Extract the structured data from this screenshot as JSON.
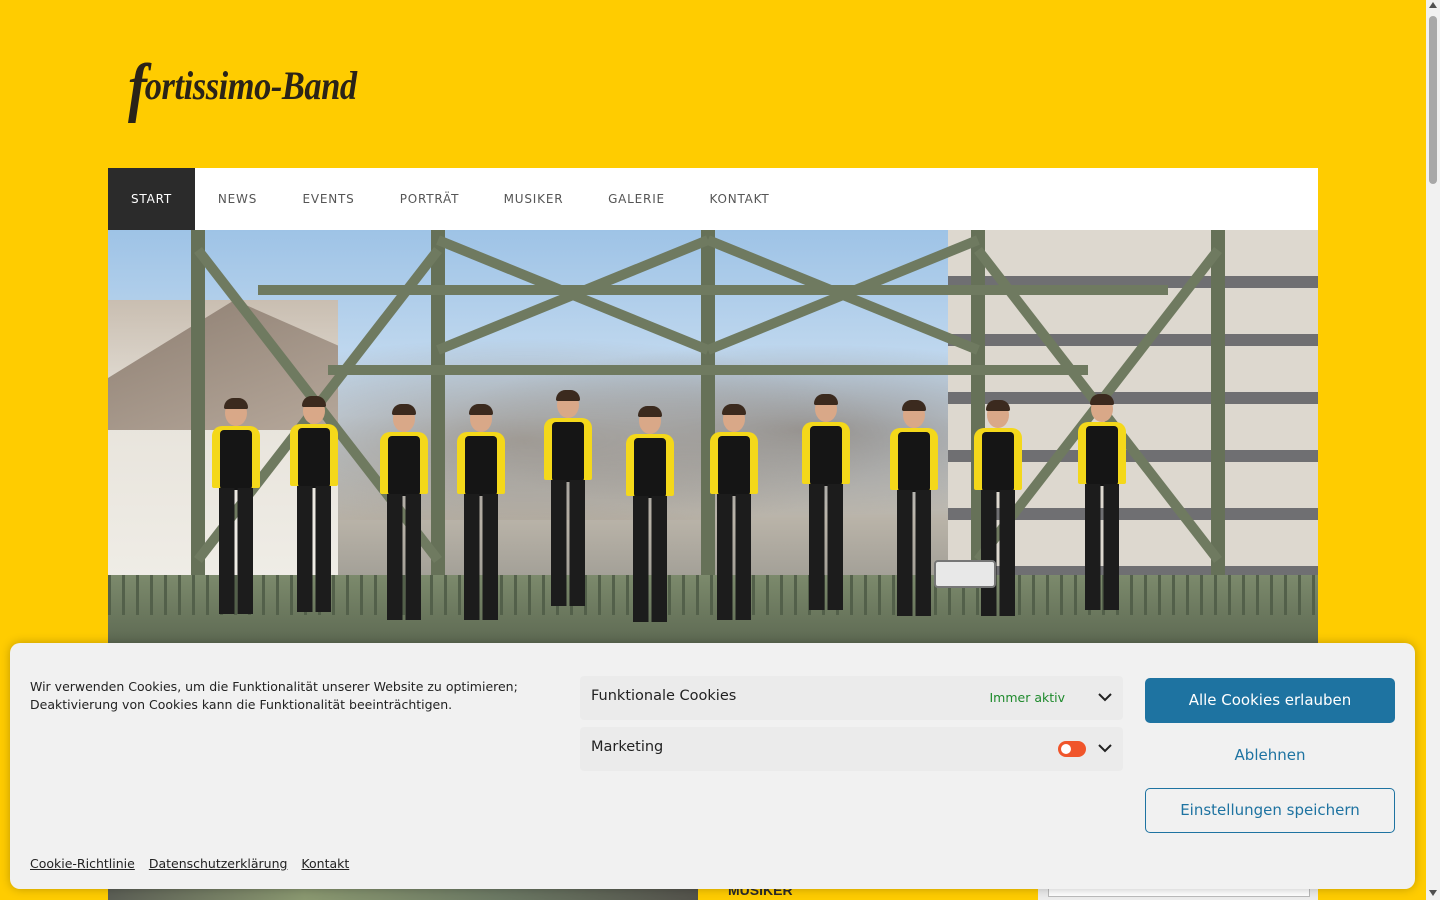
{
  "brand": {
    "logo_text_initial": "f",
    "logo_text_rest": "ortissimo-Band"
  },
  "nav": {
    "items": [
      {
        "label": "START",
        "active": true
      },
      {
        "label": "NEWS"
      },
      {
        "label": "EVENTS"
      },
      {
        "label": "PORTRÄT"
      },
      {
        "label": "MUSIKER"
      },
      {
        "label": "GALERIE"
      },
      {
        "label": "KONTAKT"
      }
    ]
  },
  "below_fold": {
    "section_label": "MUSIKER"
  },
  "cookie_banner": {
    "message": "Wir verwenden Cookies, um die Funktionalität unserer Website zu optimieren; Deaktivierung von Cookies kann die Funktionalität beeinträchtigen.",
    "categories": [
      {
        "title": "Funktionale Cookies",
        "status": "Immer aktiv"
      },
      {
        "title": "Marketing",
        "toggle_on": false
      }
    ],
    "buttons": {
      "accept_all": "Alle Cookies erlauben",
      "deny": "Ablehnen",
      "save": "Einstellungen speichern"
    },
    "links": [
      "Cookie-Richtlinie",
      "Datenschutzerklärung",
      "Kontakt"
    ]
  },
  "colors": {
    "page_background": "#ffcc00",
    "nav_active": "#2b2b2b",
    "primary_button": "#1e73a1",
    "status_active": "#1e8a2c",
    "toggle": "#f0552b"
  }
}
